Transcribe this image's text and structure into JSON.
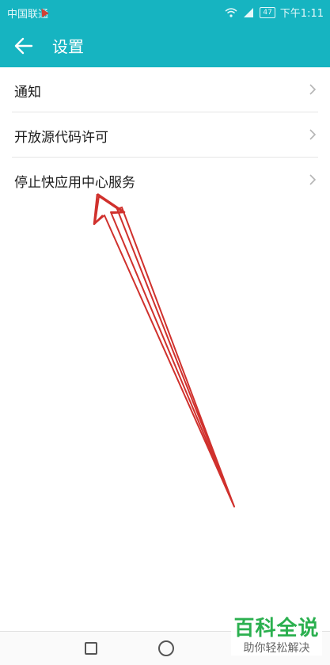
{
  "status_bar": {
    "carrier": "中国联通",
    "battery": "47",
    "time": "下午1:11"
  },
  "toolbar": {
    "back_icon": "arrow-left-icon",
    "title": "设置"
  },
  "settings": {
    "items": [
      {
        "label": "通知"
      },
      {
        "label": "开放源代码许可"
      },
      {
        "label": "停止快应用中心服务"
      }
    ]
  },
  "watermark": {
    "main": "百科全说",
    "sub": "助你轻松解决"
  },
  "colors": {
    "accent": "#16b4c1",
    "annotation_arrow": "#d0312d",
    "watermark_green": "#2bb04f"
  }
}
